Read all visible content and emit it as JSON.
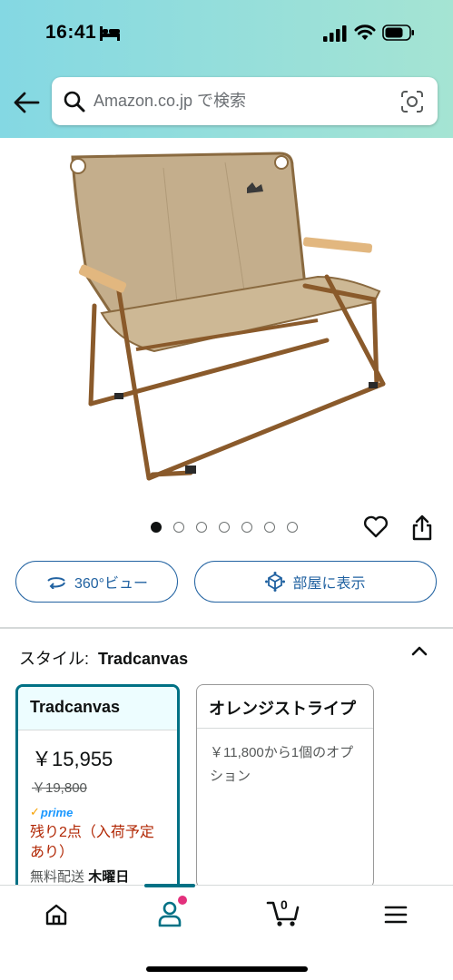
{
  "status_bar": {
    "time": "16:41"
  },
  "search": {
    "placeholder": "Amazon.co.jp で検索"
  },
  "gallery": {
    "image_count": 7,
    "active_index": 0
  },
  "actions": {
    "view_360_label": "360°ビュー",
    "view_in_room_label": "部屋に表示"
  },
  "style": {
    "label": "スタイル:",
    "value": "Tradcanvas"
  },
  "options": [
    {
      "name": "Tradcanvas",
      "price": "￥15,955",
      "list_price": "￥19,800",
      "prime_label": "prime",
      "stock": "残り2点（入荷予定あり）",
      "delivery_prefix": "無料配送",
      "delivery_day": "木曜日"
    },
    {
      "name": "オレンジストライプ",
      "note": "￥11,800から1個のオプション"
    }
  ],
  "tab_bar": {
    "cart_count": "0"
  },
  "colors": {
    "accent": "#007185",
    "link": "#2162a1",
    "stock": "#b12704",
    "header_start": "#84d8e3",
    "header_end": "#a5e4d3"
  }
}
